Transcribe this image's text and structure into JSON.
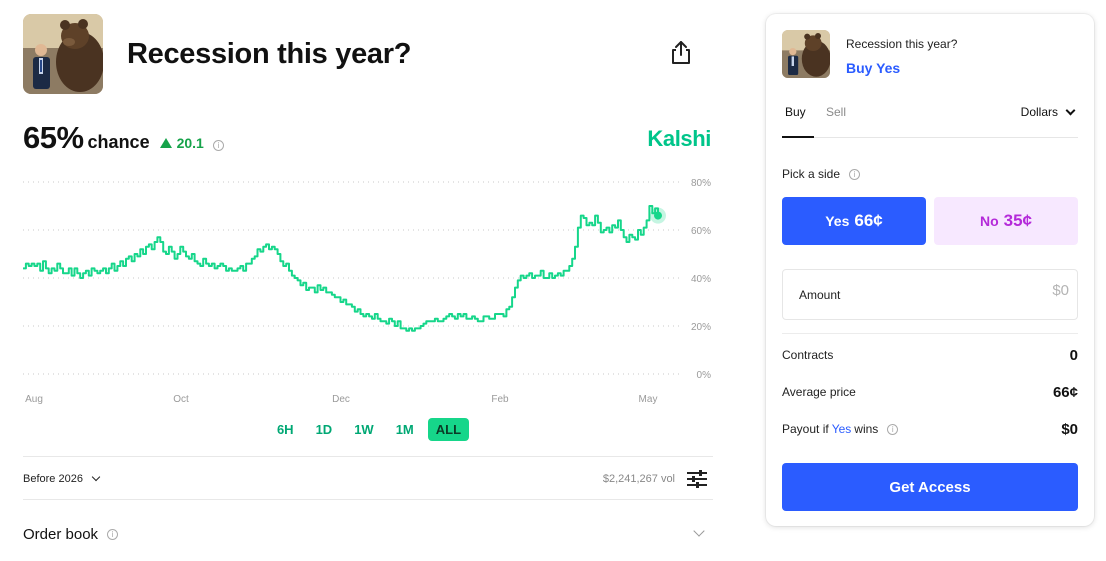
{
  "market": {
    "title": "Recession this year?",
    "chance_value": "65%",
    "chance_label": "chance",
    "delta": "20.1",
    "brand": "Kalshi",
    "ranges": [
      "6H",
      "1D",
      "1W",
      "1M",
      "ALL"
    ],
    "active_range": "ALL",
    "period_select": "Before 2026",
    "volume": "$2,241,267 vol",
    "order_book_label": "Order book",
    "icons": {
      "share": "share-icon",
      "delta": "triangle-up-icon",
      "info": "info-icon",
      "period": "chevron-down-icon",
      "filter": "sliders-icon",
      "order_book": "chevron-down-icon"
    },
    "colors": {
      "line": "#16d68a",
      "brand": "#00c58a",
      "delta": "#16a34a"
    }
  },
  "chart_data": {
    "type": "line",
    "x_ticks": [
      "Aug",
      "Oct",
      "Dec",
      "Feb",
      "May"
    ],
    "y_ticks": [
      "0%",
      "20%",
      "40%",
      "60%",
      "80%"
    ],
    "ylim": [
      0,
      80
    ],
    "grid": "horizontal-dotted",
    "series": [
      {
        "values": [
          44,
          46,
          45,
          46,
          45,
          46,
          43,
          47,
          44,
          42,
          44,
          43,
          46,
          44,
          42,
          42,
          44,
          41,
          44,
          42,
          40,
          42,
          43,
          41,
          44,
          43,
          42,
          43,
          44,
          42,
          44,
          46,
          43,
          45,
          47,
          45,
          48,
          49,
          47,
          50,
          49,
          52,
          50,
          53,
          54,
          52,
          55,
          57,
          55,
          51,
          50,
          53,
          51,
          48,
          50,
          53,
          51,
          49,
          48,
          50,
          47,
          46,
          45,
          48,
          46,
          45,
          46,
          44,
          45,
          46,
          45,
          43,
          44,
          43,
          43,
          44,
          45,
          43,
          46,
          46,
          48,
          49,
          52,
          51,
          53,
          54,
          52,
          53,
          52,
          50,
          47,
          45,
          46,
          43,
          41,
          40,
          39,
          37,
          38,
          35,
          36,
          36,
          34,
          37,
          35,
          36,
          34,
          34,
          33,
          32,
          32,
          30,
          31,
          29,
          29,
          28,
          26,
          27,
          25,
          24,
          25,
          24,
          23,
          25,
          23,
          22,
          22,
          21,
          23,
          22,
          20,
          22,
          19,
          19,
          18,
          19,
          18,
          19,
          19,
          20,
          21,
          22,
          22,
          22,
          23,
          22,
          22,
          23,
          24,
          25,
          24,
          23,
          25,
          24,
          25,
          23,
          23,
          24,
          23,
          22,
          22,
          24,
          24,
          23,
          23,
          25,
          25,
          25,
          24,
          27,
          28,
          32,
          36,
          39,
          41,
          40,
          41,
          42,
          40,
          41,
          41,
          43,
          40,
          40,
          42,
          40,
          41,
          42,
          41,
          43,
          43,
          45,
          48,
          53,
          61,
          66,
          65,
          62,
          63,
          62,
          66,
          63,
          59,
          60,
          61,
          59,
          62,
          61,
          64,
          60,
          57,
          55,
          58,
          57,
          56,
          60,
          58,
          61,
          64,
          70,
          67,
          69,
          66
        ]
      }
    ]
  },
  "trade": {
    "question": "Recession this year?",
    "selection": "Buy Yes",
    "tab_buy": "Buy",
    "tab_sell": "Sell",
    "currency": "Dollars",
    "pick_label": "Pick a side",
    "yes_label": "Yes",
    "yes_price": "66¢",
    "no_label": "No",
    "no_price": "35¢",
    "amount_label": "Amount",
    "amount_placeholder": "$0",
    "contracts_label": "Contracts",
    "contracts_value": "0",
    "avg_price_label": "Average price",
    "avg_price_value": "66¢",
    "payout_prefix": "Payout if",
    "payout_yes": "Yes",
    "payout_suffix": "wins",
    "payout_value": "$0",
    "cta": "Get Access",
    "colors": {
      "yes": "#2b5cff",
      "no_bg": "#f7e8ff",
      "no_text": "#b42ad9"
    }
  }
}
